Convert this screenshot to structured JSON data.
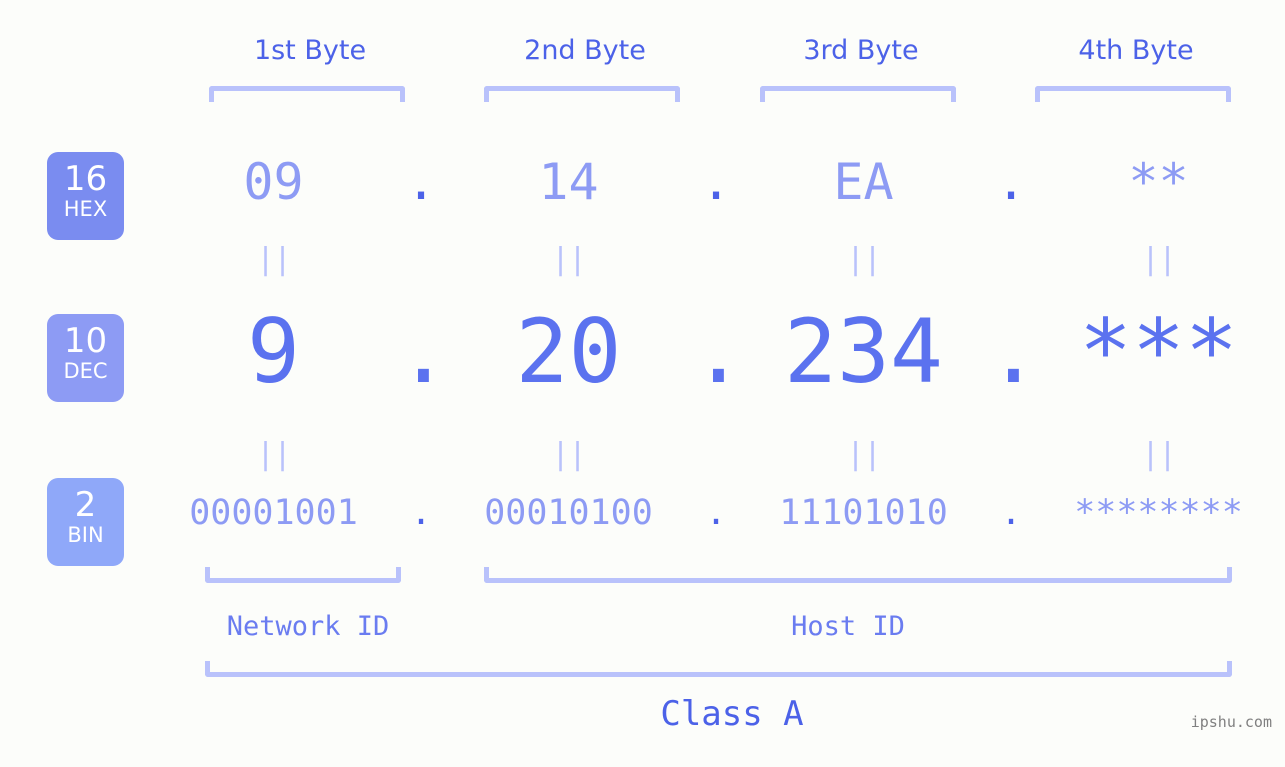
{
  "background_color": "#fcfdfa",
  "accent_color": "#4c62e8",
  "accent_light": "#8d9bf4",
  "bracket_color": "#b9c2fb",
  "byte_headers": [
    {
      "label": "1st Byte"
    },
    {
      "label": "2nd Byte"
    },
    {
      "label": "3rd Byte"
    },
    {
      "label": "4th Byte"
    }
  ],
  "bases": [
    {
      "number": "16",
      "name": "HEX",
      "color": "#7a8cf0"
    },
    {
      "number": "10",
      "name": "DEC",
      "color": "#8d9bf4"
    },
    {
      "number": "2",
      "name": "BIN",
      "color": "#8fa8f9"
    }
  ],
  "rows": {
    "hex": {
      "base_number": "16",
      "base_name": "HEX",
      "values": [
        "09",
        "14",
        "EA",
        "**"
      ],
      "separators": [
        ".",
        ".",
        "."
      ]
    },
    "dec": {
      "base_number": "10",
      "base_name": "DEC",
      "values": [
        "9",
        "20",
        "234",
        "***"
      ],
      "separators": [
        ".",
        ".",
        "."
      ]
    },
    "bin": {
      "base_number": "2",
      "base_name": "BIN",
      "values": [
        "00001001",
        "00010100",
        "11101010",
        "********"
      ],
      "separators": [
        ".",
        ".",
        "."
      ]
    }
  },
  "equality_marks": {
    "glyph": "||",
    "count_per_row": 4,
    "rows": 2
  },
  "segments": {
    "network_id": "Network ID",
    "host_id": "Host ID",
    "class": "Class A"
  },
  "watermark": "ipshu.com"
}
